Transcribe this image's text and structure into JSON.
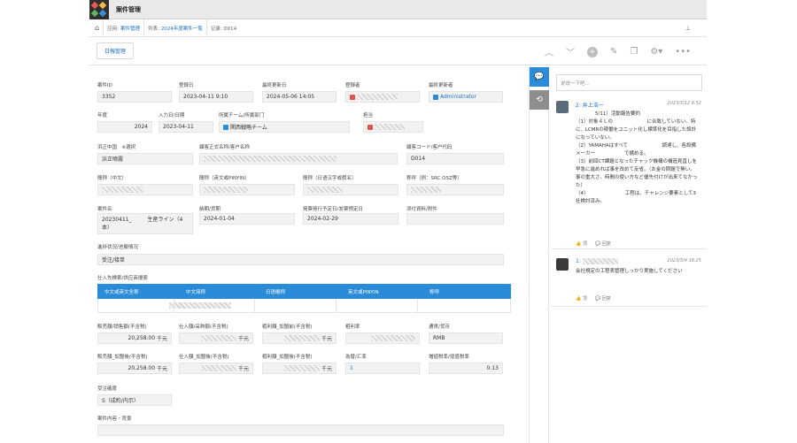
{
  "app": {
    "title": "案件管理"
  },
  "breadcrumb": {
    "app_label": "应用:",
    "app_link": "案件管理",
    "list_label": "列表:",
    "list_link": "2024年度案件一覧",
    "record": "记录: D014"
  },
  "toolbar": {
    "summary_button": "日報管理"
  },
  "fields": {
    "case_id": {
      "label": "案件ID",
      "value": "3352"
    },
    "reg_date": {
      "label": "登録日",
      "value": "2023-04-11 9:10"
    },
    "updated": {
      "label": "最終更新日",
      "value": "2024-05-06 14:05"
    },
    "registrant": {
      "label": "登録者"
    },
    "updater": {
      "label": "最終更新者",
      "value": "Administrator"
    },
    "year": {
      "label": "年度",
      "value": "2024"
    },
    "entry_date": {
      "label": "入力日/日期",
      "value": "2023-04-11"
    },
    "team": {
      "label": "所属チーム/所属部门",
      "value": "関西戦略チーム"
    },
    "owner": {
      "label": "担当"
    },
    "region": {
      "label": "浜正中国　※選択",
      "value": "浜正噴霧"
    },
    "customer_name": {
      "label": "顧客正式名称/客户名称"
    },
    "customer_code": {
      "label": "顧客コード/客户代码",
      "value": "D014"
    },
    "abbr_cn": {
      "label": "簡称（中文）"
    },
    "abbr_pinyin": {
      "label": "簡称（英文或PINYIN）"
    },
    "abbr_jp": {
      "label": "簡称（日语汉字或假名）"
    },
    "title_ex": {
      "label": "称呼（例：SRC OSZ等）"
    },
    "case_name": {
      "label": "案件名",
      "value": "20230411_　　　生産ライン（4本）"
    },
    "deadline": {
      "label": "納期/货期",
      "value": "2024-01-04"
    },
    "invoice_date": {
      "label": "発票発行予定日/发票预定日",
      "value": "2024-02-29"
    },
    "attachments": {
      "label": "添付資料/附件"
    },
    "progress": {
      "label": "進捗状況/进展情况",
      "value": "受注/接单"
    },
    "suppliers": {
      "label": "仕入先検索/供应商搜索"
    },
    "sales": {
      "label": "販売額/销售额(不含税)",
      "value": "20,258.00",
      "unit": "千元"
    },
    "purchase": {
      "label": "仕入額/采购额(不含税)",
      "unit": "千元"
    },
    "gross": {
      "label": "粗利額_加盟前(不含税)",
      "unit": "千元"
    },
    "margin": {
      "label": "粗利率"
    },
    "currency": {
      "label": "通貨/货币",
      "value": "RMB"
    },
    "sales_add": {
      "label": "販売額_加盟後(不含税)",
      "value": "20,258.00",
      "unit": "千元"
    },
    "purchase_add": {
      "label": "仕入額_加盟後(不含税)",
      "unit": "千元"
    },
    "gross_add": {
      "label": "粗利額_加盟後(不含税)",
      "unit": "千元"
    },
    "exchange": {
      "label": "為替/汇率",
      "value": "1"
    },
    "vat": {
      "label": "増値税率/增值税率",
      "value": "0.13"
    },
    "accuracy": {
      "label": "受注確度",
      "value": "S（成約/内示）"
    },
    "content": {
      "label": "案件内容・背景"
    }
  },
  "supplier_table": {
    "headers": [
      "中文或英文全称",
      "中文简称",
      "日语略称",
      "英文或PINYIN",
      "称呼"
    ]
  },
  "comments": {
    "placeholder": "说说一下吧...",
    "items": [
      {
        "num": "2:",
        "name": "井上浩一",
        "time": "2023/5/12 8:52",
        "lines": [
          "　　　　5/11）活動報告要約",
          "（1）対象４Ｌの　　　　　　　に合致していない。特に、LCMRの稼働をユニット化し標準化を目指した設計になっていない。",
          "（2）YAMAHAはすべて　　　　　　　調達し、各設備メーカー　　　　　　で纏める。",
          "（3）前回CT課題となったチャック機構の構造見直しを早急に進めれば事を改めて反省。（お金の問題で無い。事の重大さ、時間の使い方など優先付けが出来てなかった）",
          "（4）　　　　　　　　工程は、チャレンジ要素として3社検討済み。"
        ],
        "like": "顶",
        "reply": "回复"
      },
      {
        "num": "1:",
        "name": "",
        "time": "2023/5/4 18:25",
        "lines": [
          "会社規定の工程表管理しっかり実施してください　　　　"
        ],
        "like": "顶",
        "reply": "回复"
      }
    ]
  },
  "colors": {
    "accent": "#2a8bd9",
    "link": "#1e6fc8",
    "field_bg": "#f2f2f2"
  }
}
